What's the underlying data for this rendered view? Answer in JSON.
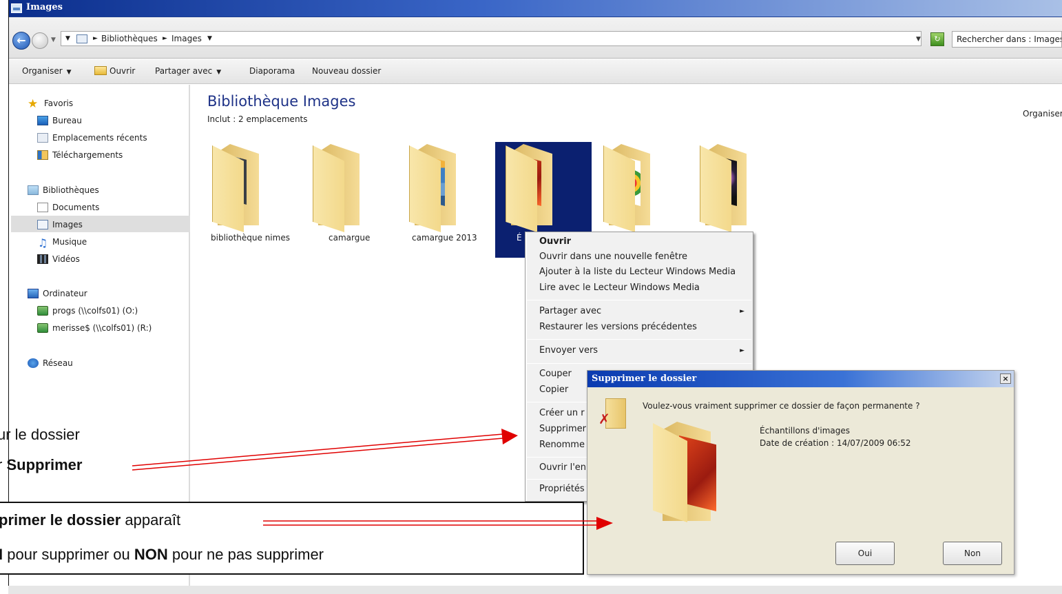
{
  "window": {
    "title": "Images"
  },
  "address": {
    "crumbs": [
      "Bibliothèques",
      "Images"
    ],
    "search_placeholder": "Rechercher dans : Images"
  },
  "toolbar": {
    "organize": "Organiser",
    "open": "Ouvrir",
    "share": "Partager avec",
    "slideshow": "Diaporama",
    "new_folder": "Nouveau dossier"
  },
  "nav": {
    "favorites": "Favoris",
    "desktop": "Bureau",
    "recent": "Emplacements récents",
    "downloads": "Téléchargements",
    "libraries": "Bibliothèques",
    "documents": "Documents",
    "images": "Images",
    "music": "Musique",
    "videos": "Vidéos",
    "computer": "Ordinateur",
    "drive1": "progs (\\\\colfs01) (O:)",
    "drive2": "merisse$ (\\\\colfs01) (R:)",
    "network": "Réseau"
  },
  "content": {
    "title": "Bibliothèque Images",
    "subtitle": "Inclut : 2 emplacements",
    "arrange_label": "Organiser",
    "folders": [
      "bibliothèque nimes",
      "camargue",
      "camargue 2013",
      "É"
    ]
  },
  "context_menu": {
    "open": "Ouvrir",
    "open_new": "Ouvrir dans une nouvelle fenêtre",
    "add_list": "Ajouter à la liste du Lecteur Windows Media",
    "play": "Lire avec le Lecteur Windows Media",
    "share": "Partager avec",
    "restore": "Restaurer les versions précédentes",
    "send_to": "Envoyer vers",
    "cut": "Couper",
    "copy": "Copier",
    "create": "Créer un r",
    "delete": "Supprimer",
    "rename": "Renomme",
    "open_loc": "Ouvrir l'en",
    "properties": "Propriétés"
  },
  "dialog": {
    "title": "Supprimer le dossier",
    "question": "Voulez-vous vraiment supprimer ce dossier de façon permanente ?",
    "folder_name": "Échantillons d'images",
    "created": "Date de création : 14/07/2009 06:52",
    "yes": "Oui",
    "no": "Non",
    "close": "×"
  },
  "annotations": {
    "line1": "ur le dossier",
    "line2_pre": "r ",
    "line2_bold": "Supprimer",
    "line3_bold": "primer le dossier",
    "line3_rest": " apparaît",
    "line4_bold1": "I",
    "line4_mid": " pour supprimer ou ",
    "line4_bold2": "NON",
    "line4_rest": " pour ne pas supprimer"
  },
  "colors": {
    "arrow": "#e00000",
    "title_blue": "#1e3287",
    "selection": "#0b2070"
  }
}
